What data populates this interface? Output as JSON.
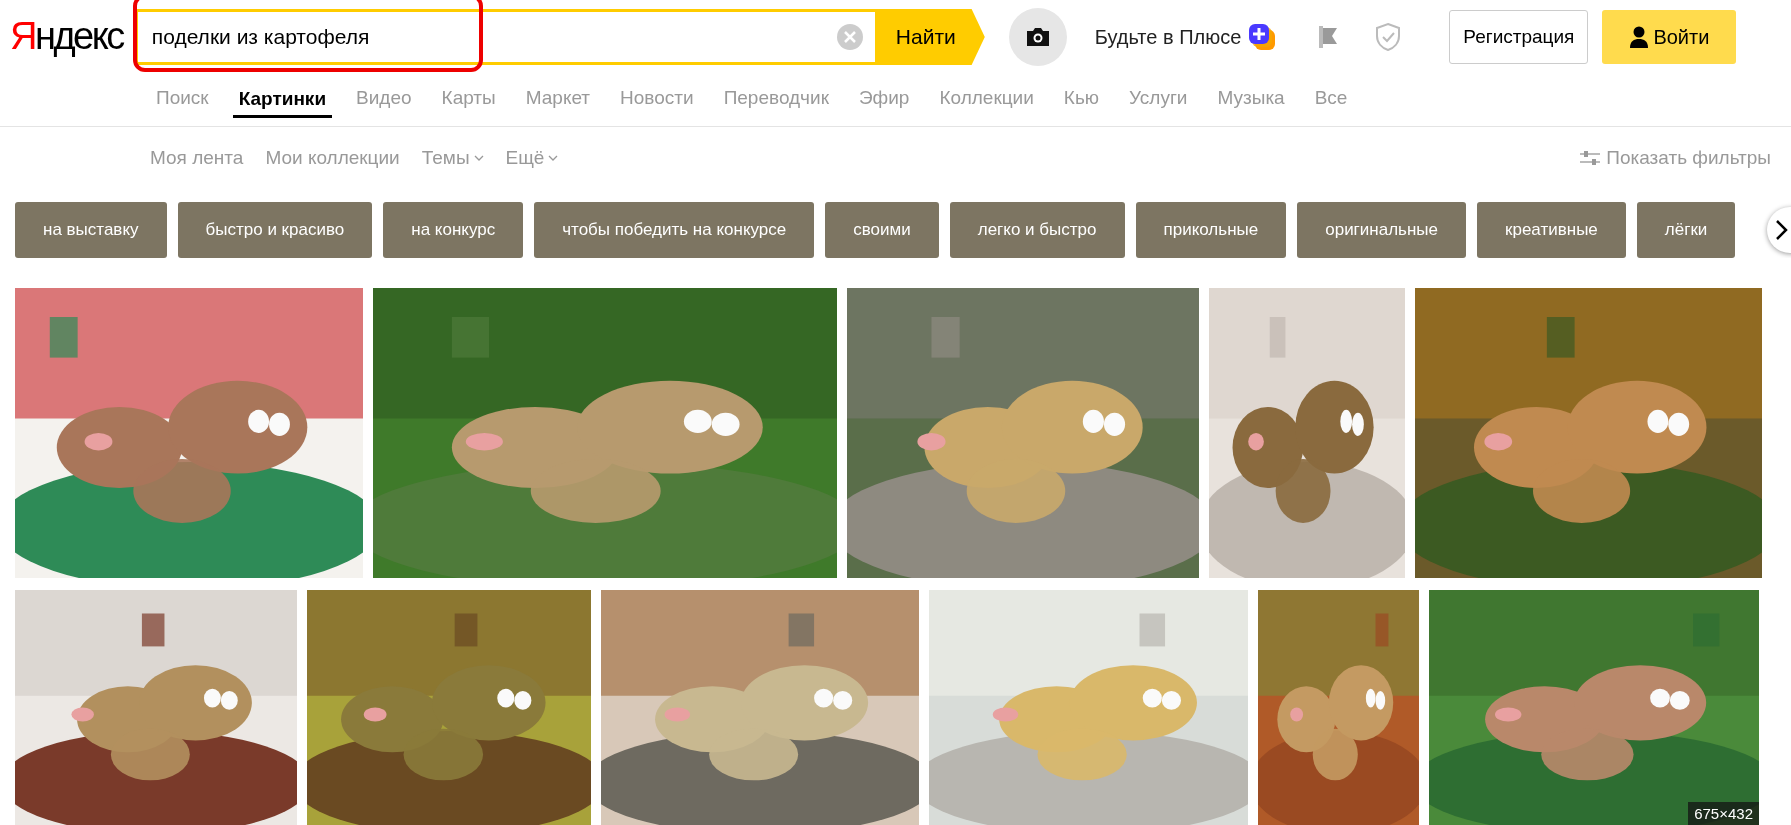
{
  "logo": "Яндекс",
  "search": {
    "value": "поделки из картофеля",
    "button": "Найти",
    "highlighted": true
  },
  "promo": "Будьте в Плюсе",
  "register": "Регистрация",
  "login": "Войти",
  "services": [
    {
      "label": "Поиск",
      "selected": false
    },
    {
      "label": "Картинки",
      "selected": true
    },
    {
      "label": "Видео",
      "selected": false
    },
    {
      "label": "Карты",
      "selected": false
    },
    {
      "label": "Маркет",
      "selected": false
    },
    {
      "label": "Новости",
      "selected": false
    },
    {
      "label": "Переводчик",
      "selected": false
    },
    {
      "label": "Эфир",
      "selected": false
    },
    {
      "label": "Коллекции",
      "selected": false
    },
    {
      "label": "Кью",
      "selected": false
    },
    {
      "label": "Услуги",
      "selected": false
    },
    {
      "label": "Музыка",
      "selected": false
    },
    {
      "label": "Все",
      "selected": false
    }
  ],
  "subnav": [
    {
      "label": "Моя лента",
      "dropdown": false
    },
    {
      "label": "Мои коллекции",
      "dropdown": false
    },
    {
      "label": "Темы",
      "dropdown": true
    },
    {
      "label": "Ещё",
      "dropdown": true
    }
  ],
  "filters": "Показать фильтры",
  "chips": [
    "на выставку",
    "быстро и красиво",
    "на конкурс",
    "чтобы победить на конкурсе",
    "своими",
    "легко и быстро",
    "прикольные",
    "оригинальные",
    "креативные",
    "лёгки"
  ],
  "image_rows": [
    [
      {
        "kind": "picture"
      },
      {
        "kind": "picture"
      },
      {
        "kind": "picture"
      },
      {
        "kind": "picture"
      },
      {
        "kind": "picture"
      }
    ],
    [
      {
        "kind": "picture"
      },
      {
        "kind": "picture"
      },
      {
        "kind": "picture"
      },
      {
        "kind": "picture"
      },
      {
        "kind": "picture"
      },
      {
        "kind": "picture",
        "size": "675×432"
      }
    ]
  ]
}
